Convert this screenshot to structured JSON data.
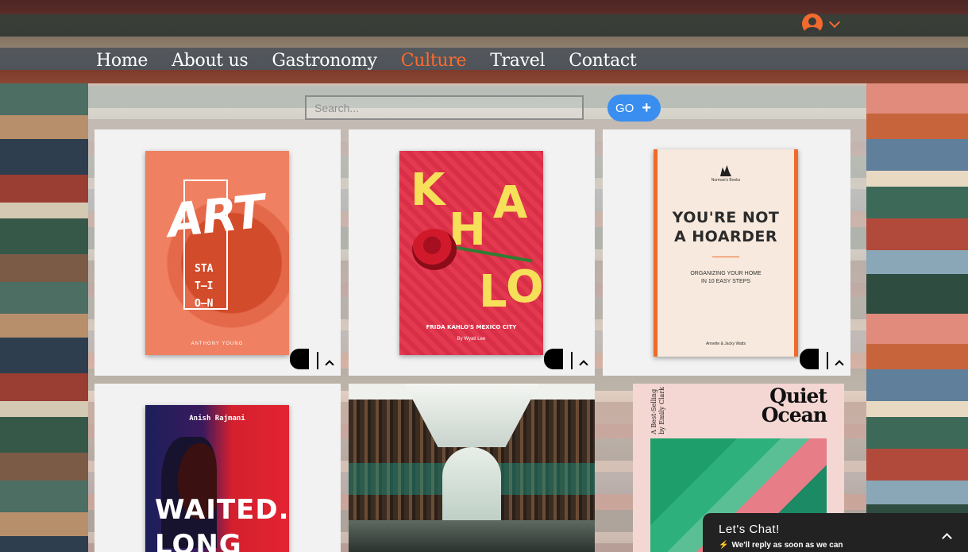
{
  "nav": {
    "items": [
      {
        "label": "Home",
        "active": false
      },
      {
        "label": "About us",
        "active": false
      },
      {
        "label": "Gastronomy",
        "active": false
      },
      {
        "label": "Culture",
        "active": true
      },
      {
        "label": "Travel",
        "active": false
      },
      {
        "label": "Contact",
        "active": false
      }
    ]
  },
  "account": {
    "icon": "user-avatar-icon",
    "dropdown_icon": "chevron-down-icon",
    "accent": "#f26a2e"
  },
  "search": {
    "placeholder": "Search...",
    "value": ""
  },
  "go_button": {
    "label": "GO",
    "icon": "plus-icon",
    "color": "#3a8ef0"
  },
  "accent_active_nav": "#ff6a2c",
  "books": [
    {
      "cover_title": "ART",
      "cover_sub": "STA\nT—I\nO—N",
      "cover_author": "ANTHONY YOUNG"
    },
    {
      "cover_letters": [
        "K",
        "A",
        "H",
        "L",
        "O"
      ],
      "cover_sub": "FRIDA KAHLO'S MEXICO CITY",
      "cover_author": "By Wyatt Lee"
    },
    {
      "publisher": "Norman's Books",
      "cover_title": "YOU'RE NOT\nA HOARDER",
      "cover_sub": "ORGANIZING YOUR HOME\nIN 10 EASY STEPS",
      "cover_author": "Annette & Jacky Watts"
    },
    {
      "cover_author": "Anish Rajmani",
      "cover_title_1": "WAITED.",
      "cover_title_2": "LONG"
    },
    {
      "image": "library-interior-photo"
    },
    {
      "side_text": "A Best-Selling\nby Emily Clark",
      "cover_title": "Quiet\nOcean"
    }
  ],
  "chat": {
    "title": "Let's Chat!",
    "subtitle": "We'll reply as soon as we can",
    "bolt_icon": "lightning-icon",
    "toggle_icon": "chevron-up-icon"
  }
}
